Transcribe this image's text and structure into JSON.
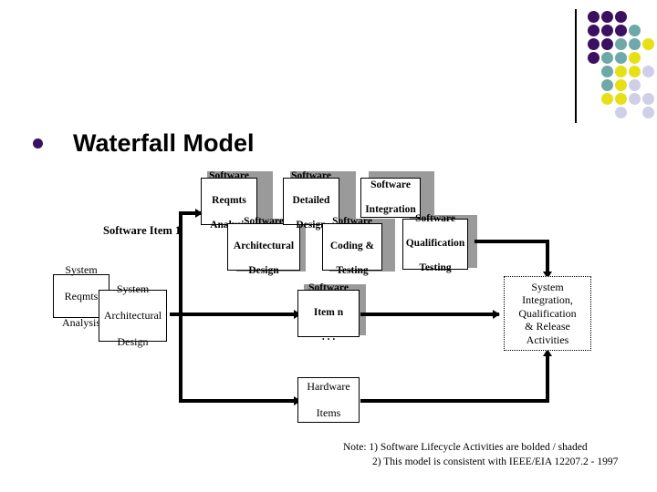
{
  "slide": {
    "title": "Waterfall Model",
    "bullet_color": "#3B1060",
    "background": "#FFFFFF"
  },
  "logo": {
    "name": "dot-matrix-logo",
    "colors": {
      "purple": "#3B1060",
      "teal": "#6FA8A8",
      "yellow": "#E8E016",
      "lavender": "#CFD0E8"
    },
    "dots": [
      {
        "row": 0,
        "col": 0,
        "color": "#3B1060"
      },
      {
        "row": 0,
        "col": 1,
        "color": "#3B1060"
      },
      {
        "row": 0,
        "col": 2,
        "color": "#3B1060"
      },
      {
        "row": 1,
        "col": 0,
        "color": "#3B1060"
      },
      {
        "row": 1,
        "col": 1,
        "color": "#3B1060"
      },
      {
        "row": 1,
        "col": 2,
        "color": "#3B1060"
      },
      {
        "row": 1,
        "col": 3,
        "color": "#6FA8A8"
      },
      {
        "row": 2,
        "col": 0,
        "color": "#3B1060"
      },
      {
        "row": 2,
        "col": 1,
        "color": "#3B1060"
      },
      {
        "row": 2,
        "col": 2,
        "color": "#6FA8A8"
      },
      {
        "row": 2,
        "col": 3,
        "color": "#6FA8A8"
      },
      {
        "row": 2,
        "col": 4,
        "color": "#E8E016"
      },
      {
        "row": 3,
        "col": 0,
        "color": "#3B1060"
      },
      {
        "row": 3,
        "col": 1,
        "color": "#6FA8A8"
      },
      {
        "row": 3,
        "col": 2,
        "color": "#6FA8A8"
      },
      {
        "row": 3,
        "col": 3,
        "color": "#E8E016"
      },
      {
        "row": 4,
        "col": 1,
        "color": "#6FA8A8"
      },
      {
        "row": 4,
        "col": 2,
        "color": "#E8E016"
      },
      {
        "row": 4,
        "col": 3,
        "color": "#E8E016"
      },
      {
        "row": 4,
        "col": 4,
        "color": "#CFD0E8"
      },
      {
        "row": 5,
        "col": 1,
        "color": "#6FA8A8"
      },
      {
        "row": 5,
        "col": 2,
        "color": "#E8E016"
      },
      {
        "row": 5,
        "col": 3,
        "color": "#CFD0E8"
      },
      {
        "row": 6,
        "col": 1,
        "color": "#E8E016"
      },
      {
        "row": 6,
        "col": 2,
        "color": "#E8E016"
      },
      {
        "row": 6,
        "col": 3,
        "color": "#CFD0E8"
      },
      {
        "row": 6,
        "col": 4,
        "color": "#CFD0E8"
      },
      {
        "row": 7,
        "col": 2,
        "color": "#CFD0E8"
      },
      {
        "row": 7,
        "col": 4,
        "color": "#CFD0E8"
      }
    ]
  },
  "diagram": {
    "label_software_item_1": "Software Item 1",
    "boxes": {
      "system_reqmts_analysis": "System\nReqmts\nAnalysis",
      "system_reqmts_analysis_lines": [
        "System",
        "Reqmts",
        "Analysis"
      ],
      "system_architectural_design_lines": [
        "System",
        "Architectural",
        "Design"
      ],
      "software_reqmts_analysis_lines": [
        "Software",
        "Reqmts",
        "Analysis"
      ],
      "software_architectural_design_lines": [
        "Software",
        "Architectural",
        "Design"
      ],
      "software_detailed_design_lines": [
        "Software",
        "Detailed",
        "Design"
      ],
      "software_coding_testing_lines": [
        "Software",
        "Coding &",
        "Testing"
      ],
      "software_integration_lines": [
        "Software",
        "Integration"
      ],
      "software_qualification_testing_lines": [
        "Software",
        "Qualification",
        "Testing"
      ],
      "software_item_n_lines": [
        "Software",
        "Item n",
        ". . ."
      ],
      "hardware_items_lines": [
        "Hardware",
        "Items"
      ],
      "system_integration_activities_lines": [
        "System",
        "Integration,",
        "Qualification",
        "& Release",
        "Activities"
      ]
    },
    "shadow_color": "#9A9A9A"
  },
  "footnote": {
    "line1": "Note: 1) Software Lifecycle Activities are bolded / shaded",
    "line2": "2) This model is consistent with IEEE/EIA 12207.2 - 1997"
  }
}
